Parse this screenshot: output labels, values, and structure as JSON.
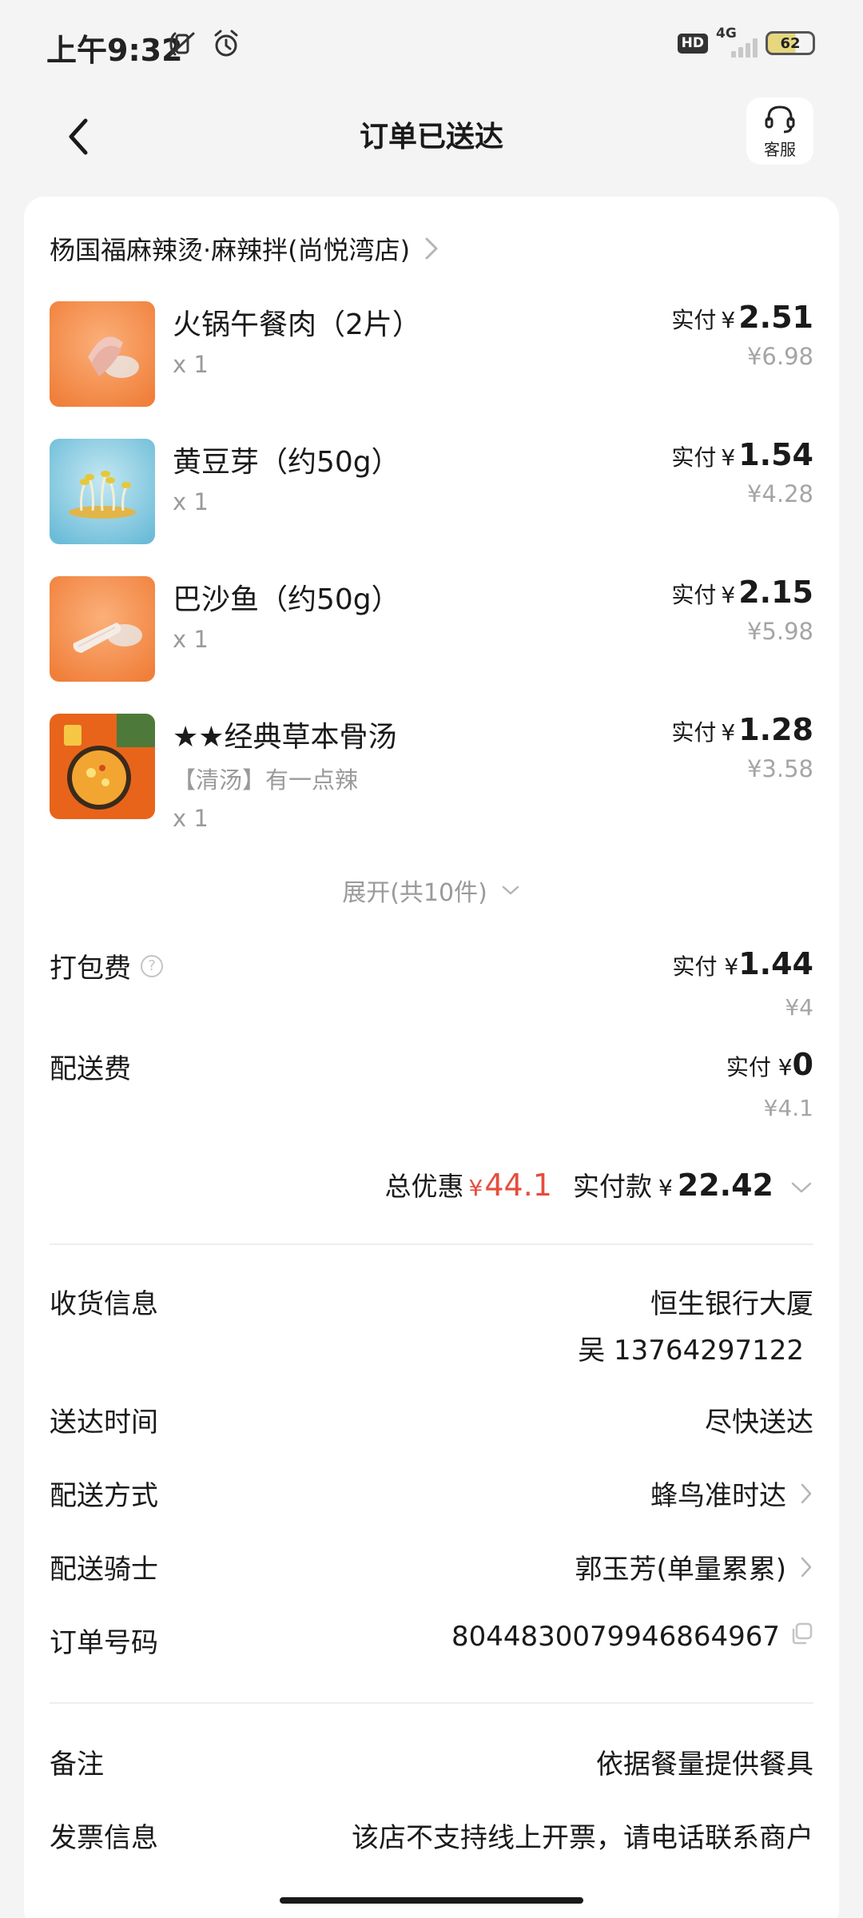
{
  "status_bar": {
    "time": "上午9:32",
    "hd": "HD",
    "network": "4G",
    "battery": "62"
  },
  "header": {
    "title": "订单已送达",
    "service_label": "客服"
  },
  "shop": {
    "name": "杨国福麻辣烫·麻辣拌(尚悦湾店)"
  },
  "items": [
    {
      "name": "火锅午餐肉（2片）",
      "spec": "",
      "qty": "x 1",
      "paid_label": "实付",
      "yen": "¥",
      "paid": "2.51",
      "original": "¥6.98",
      "thumb_bg": "#f48e4a"
    },
    {
      "name": "黄豆芽（约50g）",
      "spec": "",
      "qty": "x 1",
      "paid_label": "实付",
      "yen": "¥",
      "paid": "1.54",
      "original": "¥4.28",
      "thumb_bg": "#7ec6e0"
    },
    {
      "name": "巴沙鱼（约50g）",
      "spec": "",
      "qty": "x 1",
      "paid_label": "实付",
      "yen": "¥",
      "paid": "2.15",
      "original": "¥5.98",
      "thumb_bg": "#f48e4a"
    },
    {
      "name": "★★经典草本骨汤",
      "spec": "【清汤】有一点辣",
      "qty": "x 1",
      "paid_label": "实付",
      "yen": "¥",
      "paid": "1.28",
      "original": "¥3.58",
      "thumb_bg": "#e8641b"
    }
  ],
  "expand": "展开(共10件)",
  "fees": [
    {
      "label": "打包费",
      "paid_label": "实付 ¥",
      "paid": "1.44",
      "original": "¥4"
    },
    {
      "label": "配送费",
      "paid_label": "实付 ¥",
      "paid": "0",
      "original": "¥4.1"
    }
  ],
  "totals": {
    "discount_label": "总优惠",
    "discount_yen": "¥",
    "discount": "44.1",
    "pay_label": "实付款",
    "pay_yen": "¥",
    "pay": "22.42"
  },
  "info": {
    "address_label": "收货信息",
    "address": "恒生银行大厦",
    "contact": "吴 13764297122",
    "time_label": "送达时间",
    "time": "尽快送达",
    "method_label": "配送方式",
    "method": "蜂鸟准时达",
    "rider_label": "配送骑士",
    "rider": "郭玉芳(单量累累)",
    "order_label": "订单号码",
    "order_no": "8044830079946864967",
    "remark_label": "备注",
    "remark": "依据餐量提供餐具",
    "invoice_label": "发票信息",
    "invoice": "该店不支持线上开票，请电话联系商户"
  },
  "colors": {
    "accent_discount": "#e64d3d",
    "background": "#f4f4f4",
    "card": "#ffffff"
  }
}
